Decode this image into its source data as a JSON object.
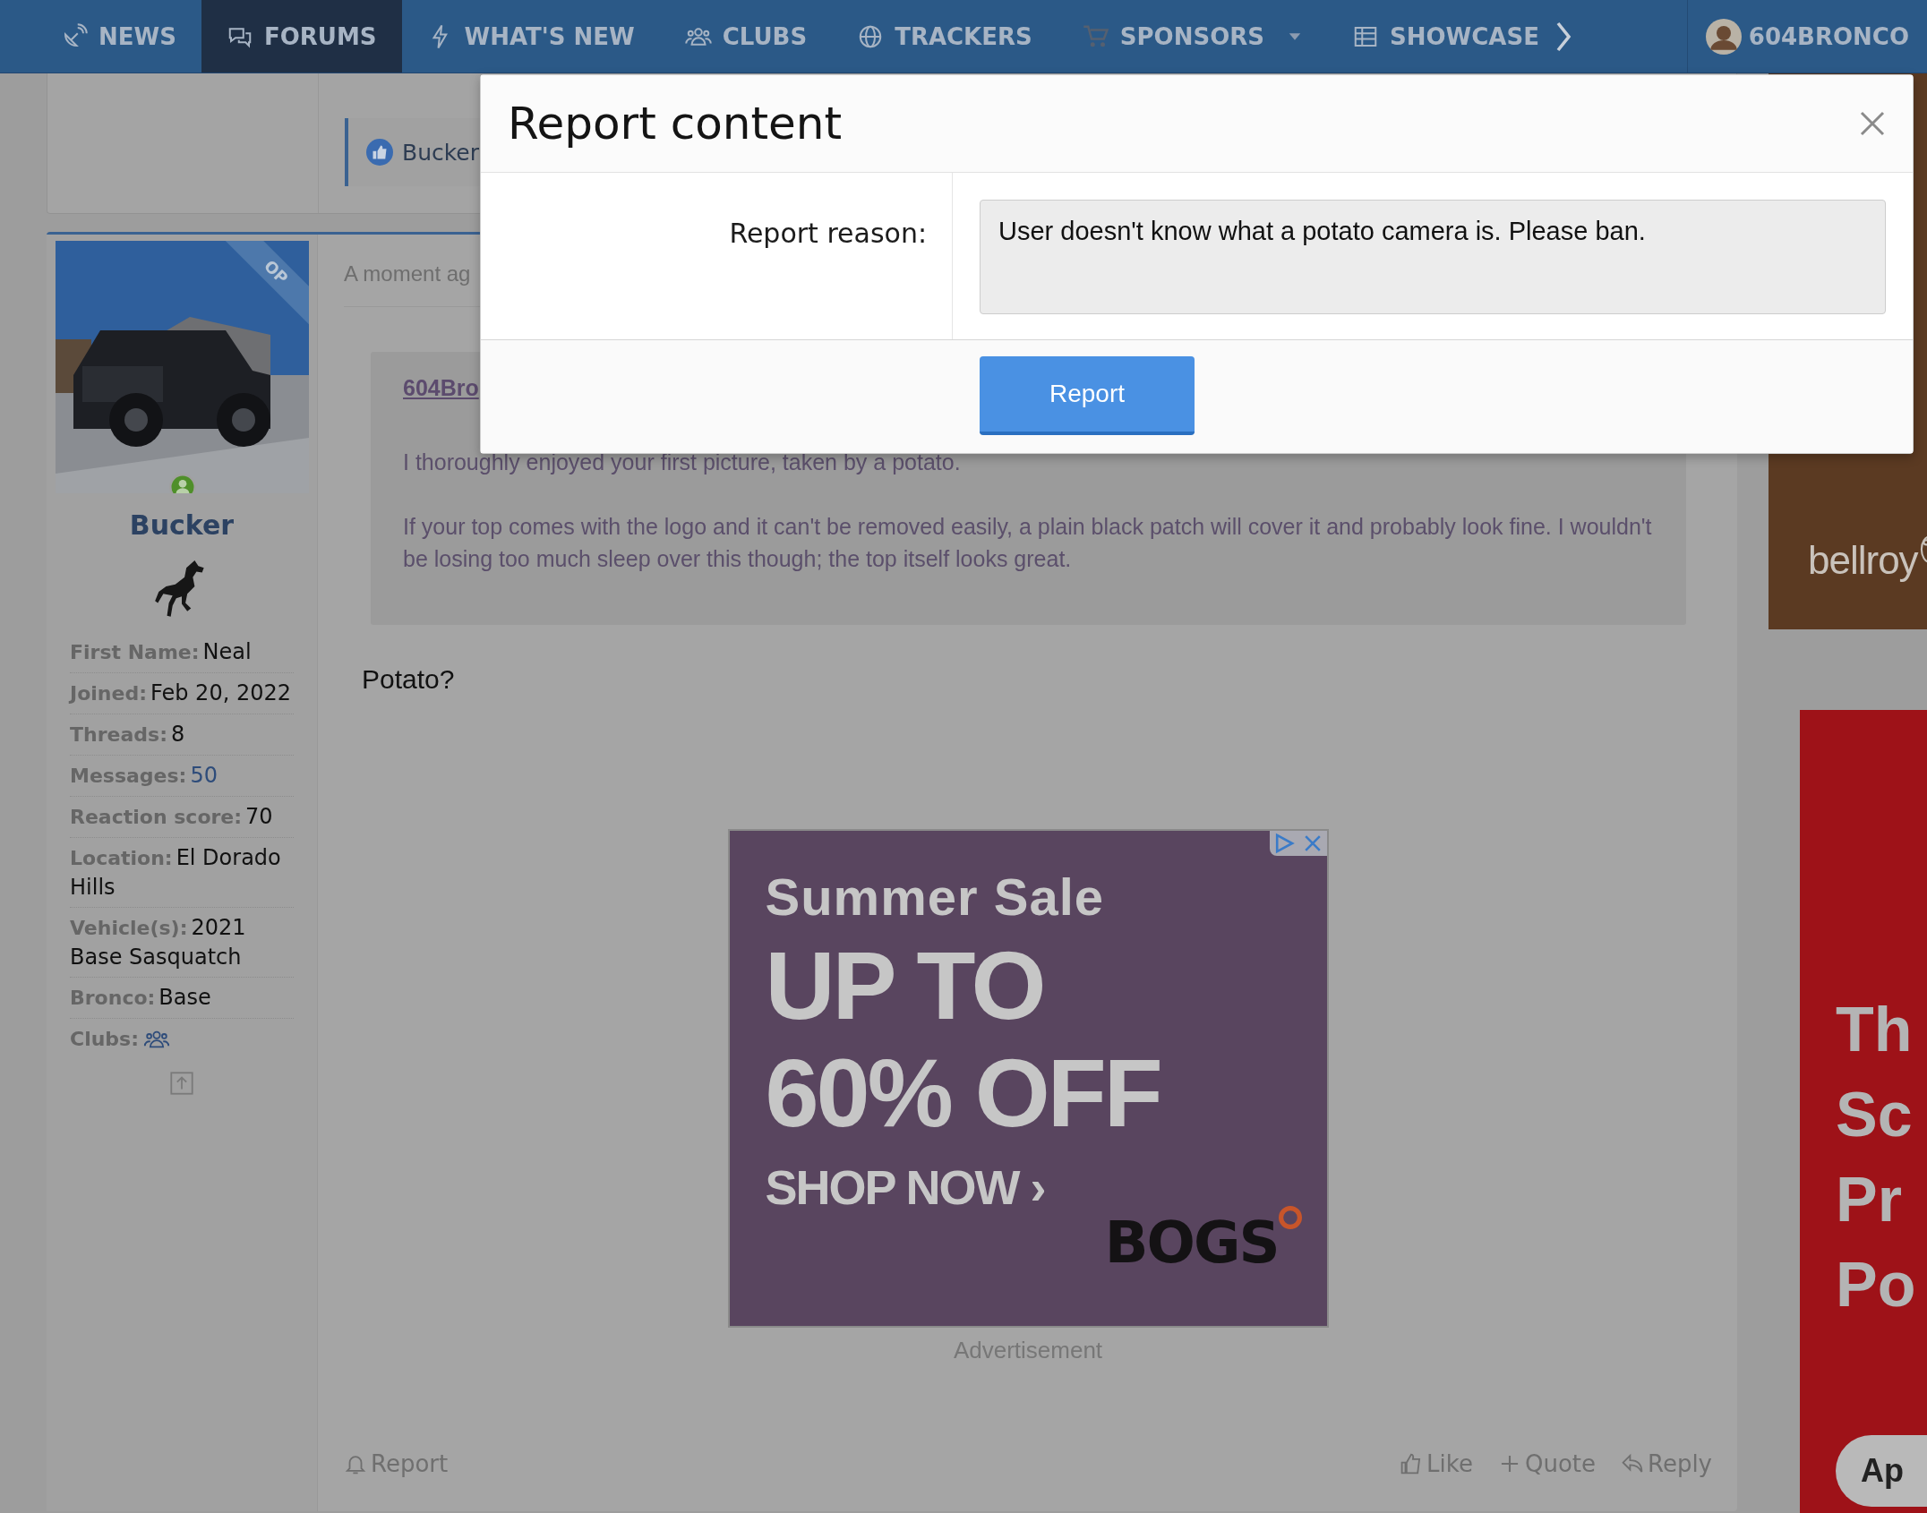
{
  "nav": {
    "items": [
      {
        "label": "NEWS",
        "selected": false,
        "dropdown": false
      },
      {
        "label": "FORUMS",
        "selected": true,
        "dropdown": false
      },
      {
        "label": "WHAT'S NEW",
        "selected": false,
        "dropdown": false
      },
      {
        "label": "CLUBS",
        "selected": false,
        "dropdown": false
      },
      {
        "label": "TRACKERS",
        "selected": false,
        "dropdown": false
      },
      {
        "label": "SPONSORS",
        "selected": false,
        "dropdown": true
      },
      {
        "label": "SHOWCASE",
        "selected": false,
        "dropdown": false
      }
    ],
    "user": {
      "name": "604BRONCO"
    }
  },
  "previous_post": {
    "reactions": {
      "text": "Bucker"
    }
  },
  "post": {
    "author": {
      "name": "Bucker",
      "online": true,
      "badge": "OP",
      "fields": [
        {
          "label": "First Name:",
          "kind": "text",
          "value": "Neal"
        },
        {
          "label": "Joined:",
          "kind": "text",
          "value": "Feb 20, 2022"
        },
        {
          "label": "Threads:",
          "kind": "text",
          "value": "8"
        },
        {
          "label": "Messages:",
          "kind": "link",
          "value": "50"
        },
        {
          "label": "Reaction score:",
          "kind": "text",
          "value": "70"
        },
        {
          "label": "Location:",
          "kind": "text",
          "value": "El Dorado Hills"
        },
        {
          "label": "Vehicle(s):",
          "kind": "text",
          "value": "2021 Base Sasquatch"
        },
        {
          "label": "Bronco:",
          "kind": "text",
          "value": "Base"
        },
        {
          "label": "Clubs:",
          "kind": "icon"
        }
      ]
    },
    "time": "A moment ag",
    "quote": {
      "author": "604Bro",
      "paragraphs": [
        "I thoroughly enjoyed your first picture, taken by a potato.",
        "If your top comes with the logo and it can't be removed easily, a plain black patch will cover it and probably look fine. I wouldn't be losing too much sleep over this though; the top itself looks great."
      ]
    },
    "body": "Potato?",
    "ad": {
      "lines": [
        "Summer Sale",
        "UP TO",
        "60% OFF",
        "SHOP NOW ›"
      ],
      "brand": "BOGS",
      "caption": "Advertisement"
    },
    "actions": {
      "left": [
        {
          "label": "Report"
        }
      ],
      "right": [
        {
          "label": "Like"
        },
        {
          "label": "Quote"
        },
        {
          "label": "Reply"
        }
      ]
    }
  },
  "side_ads": [
    {
      "kind": "brand",
      "text": "bellroy"
    },
    {
      "kind": "promo",
      "lines": [
        "Th",
        "Sc",
        "Pr",
        "Po"
      ],
      "button": "Ap"
    }
  ],
  "modal": {
    "title": "Report content",
    "field_label": "Report reason:",
    "value": "User doesn't know what a potato camera is. Please ban.",
    "button": "Report"
  }
}
